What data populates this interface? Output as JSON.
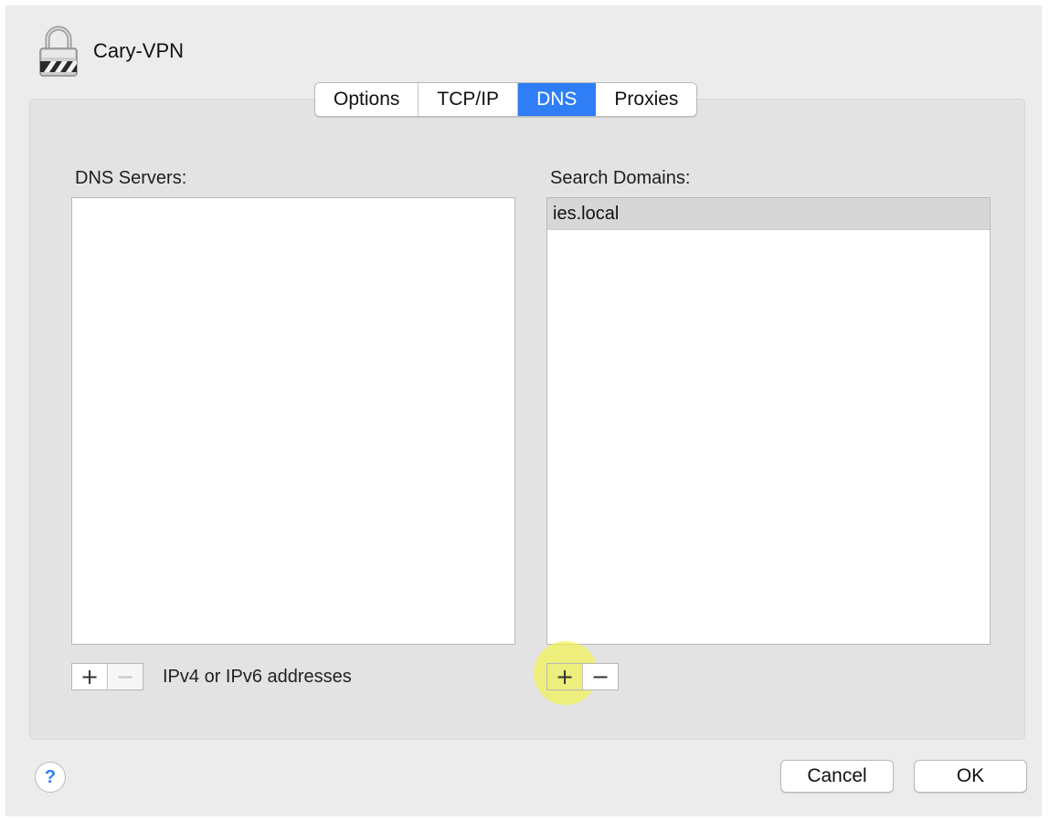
{
  "window": {
    "title": "Cary-VPN"
  },
  "tabs": [
    {
      "label": "Options"
    },
    {
      "label": "TCP/IP"
    },
    {
      "label": "DNS",
      "selected": true
    },
    {
      "label": "Proxies"
    }
  ],
  "dns_servers": {
    "label": "DNS Servers:",
    "items": [],
    "add_label": "+",
    "remove_label": "−",
    "hint": "IPv4 or IPv6 addresses"
  },
  "search_domains": {
    "label": "Search Domains:",
    "items": [
      {
        "value": "ies.local"
      }
    ],
    "add_label": "+",
    "remove_label": "−"
  },
  "footer": {
    "help_label": "?",
    "cancel_label": "Cancel",
    "ok_label": "OK"
  },
  "colors": {
    "accent": "#2f7ef6",
    "highlight": "#f5f546"
  }
}
